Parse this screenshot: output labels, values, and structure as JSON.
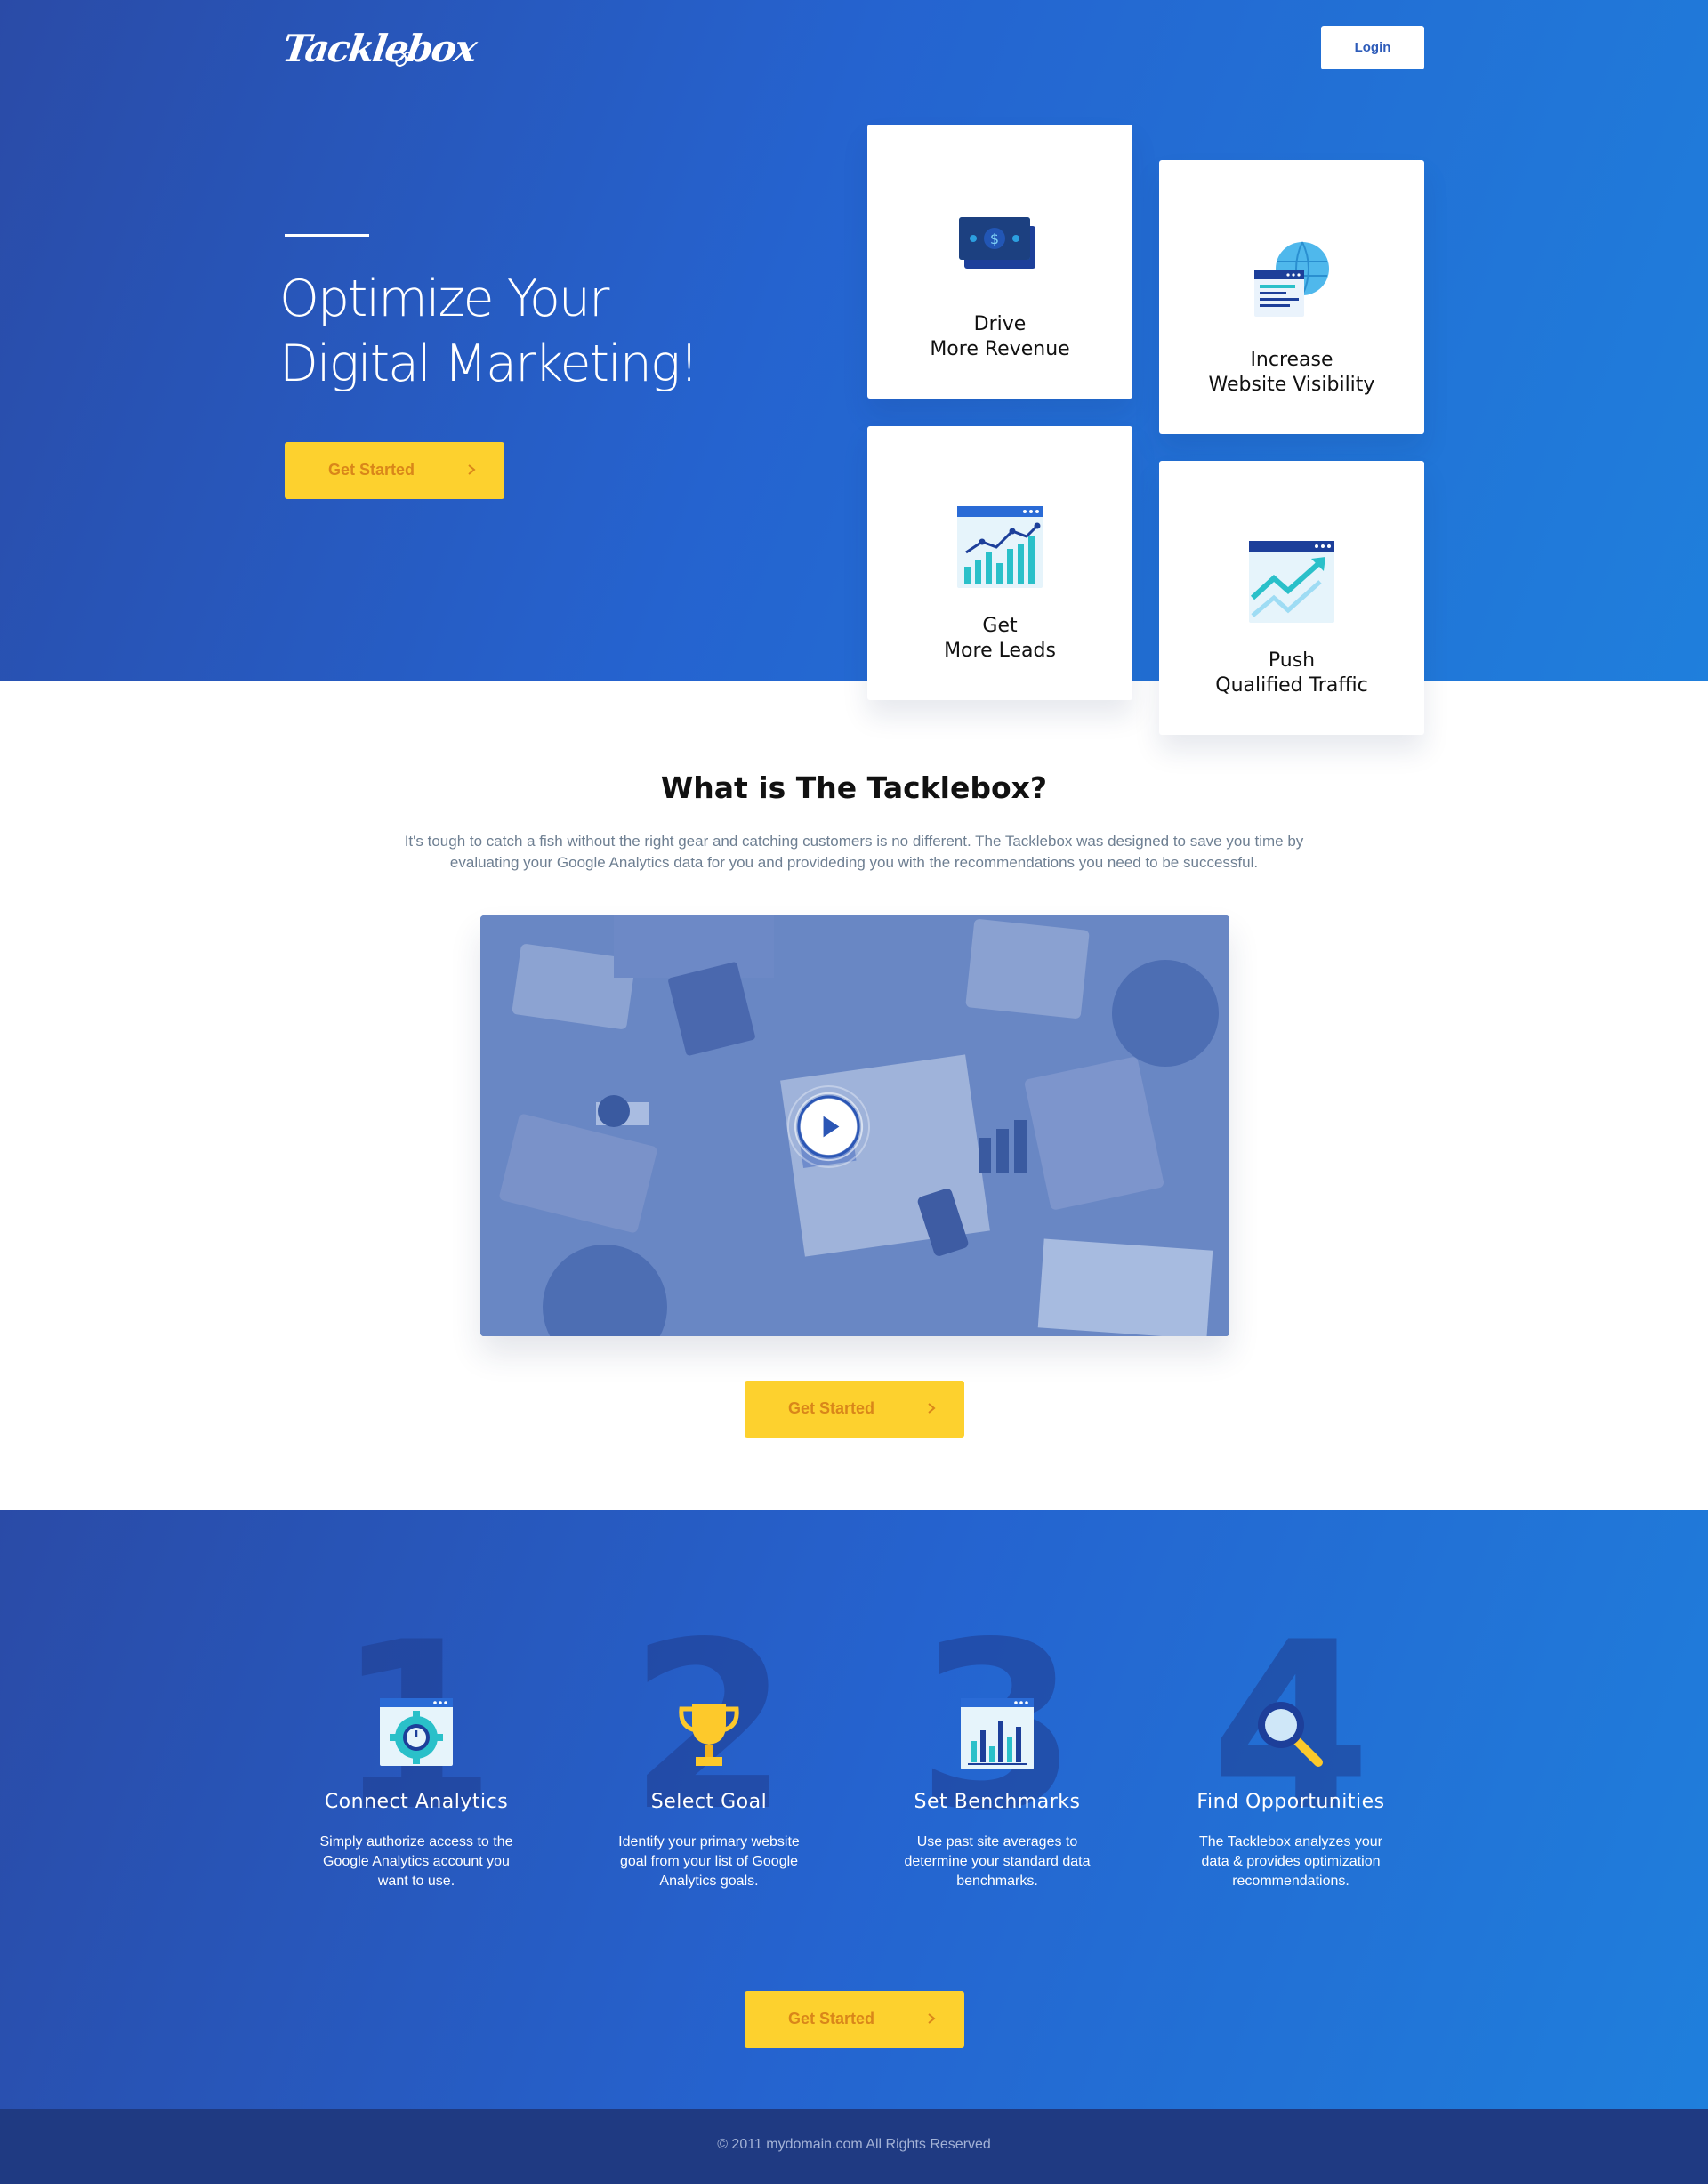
{
  "header": {
    "logo_text": "Tacklebox",
    "login_label": "Login"
  },
  "hero": {
    "title": "Optimize Your\nDigital Marketing!",
    "cta_label": "Get Started"
  },
  "benefits": [
    {
      "title": "Drive\nMore Revenue",
      "icon": "money-icon"
    },
    {
      "title": "Increase\nWebsite Visibility",
      "icon": "globe-browser-icon"
    },
    {
      "title": "Get\nMore Leads",
      "icon": "chart-browser-icon"
    },
    {
      "title": "Push\nQualified Traffic",
      "icon": "trend-browser-icon"
    }
  ],
  "about": {
    "title": "What is The Tacklebox?",
    "description": "It's tough to catch a fish without the right gear and catching customers is no different. The Tacklebox was designed to save you time by evaluating your Google Analytics data for you and provideding you with the recommendations you need to be successful.",
    "cta_label": "Get Started"
  },
  "steps": [
    {
      "number": "1",
      "title": "Connect Analytics",
      "description": "Simply authorize access to the Google Analytics account you want to use.",
      "icon": "gear-browser-icon"
    },
    {
      "number": "2",
      "title": "Select Goal",
      "description": "Identify your primary website goal from your list of Google Analytics goals.",
      "icon": "trophy-icon"
    },
    {
      "number": "3",
      "title": "Set Benchmarks",
      "description": "Use past site averages to determine your standard data benchmarks.",
      "icon": "bar-chart-browser-icon"
    },
    {
      "number": "4",
      "title": "Find Opportunities",
      "description": "The Tacklebox analyzes your data & provides optimization recommendations.",
      "icon": "magnifier-icon"
    }
  ],
  "steps_cta_label": "Get Started",
  "footer": {
    "text": "© 2011 mydomain.com All Rights Reserved"
  },
  "colors": {
    "hero_blue_start": "#2a4ba7",
    "hero_blue_end": "#1f7fdc",
    "cta_yellow": "#fdd12e",
    "cta_text": "#d9861a",
    "footer_bg": "#1f3a82"
  }
}
